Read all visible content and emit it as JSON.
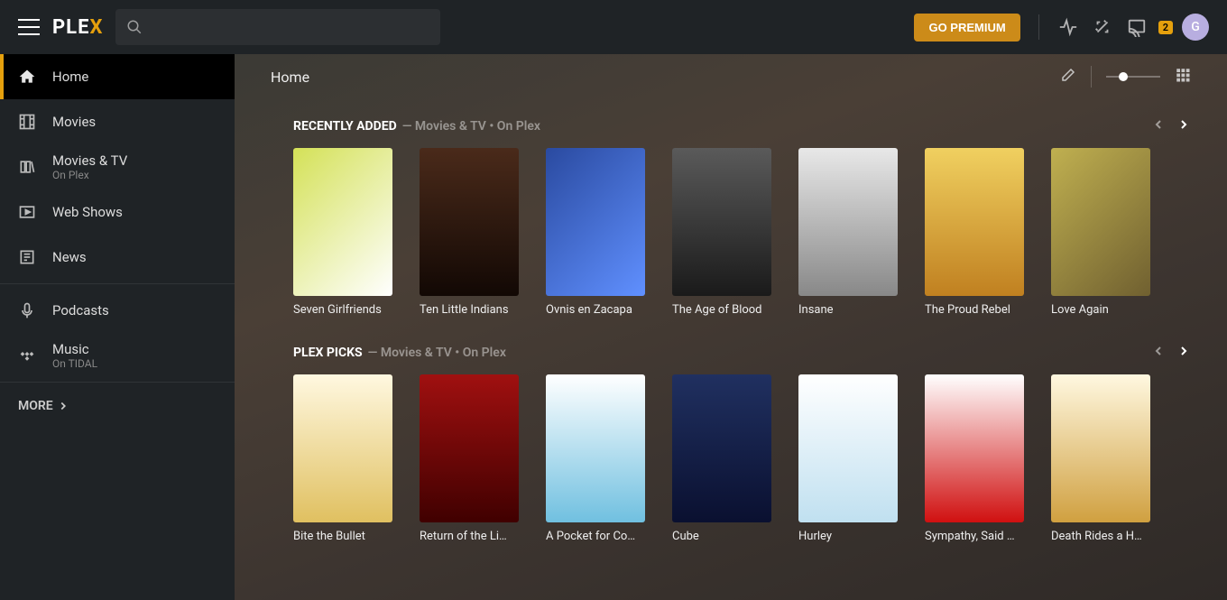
{
  "header": {
    "premium_label": "GO PREMIUM",
    "notification_count": "2",
    "avatar_letter": "G"
  },
  "sidebar": {
    "items": [
      {
        "label": "Home"
      },
      {
        "label": "Movies"
      },
      {
        "label": "Movies & TV",
        "sub": "On Plex"
      },
      {
        "label": "Web Shows"
      },
      {
        "label": "News"
      },
      {
        "label": "Podcasts"
      },
      {
        "label": "Music",
        "sub": "On TIDAL"
      }
    ],
    "more_label": "MORE"
  },
  "main": {
    "title": "Home"
  },
  "sections": [
    {
      "title": "RECENTLY ADDED",
      "subtitle": "— Movies & TV • On Plex",
      "items": [
        {
          "title": "Seven Girlfriends"
        },
        {
          "title": "Ten Little Indians"
        },
        {
          "title": "Ovnis en Zacapa"
        },
        {
          "title": "The Age of Blood"
        },
        {
          "title": "Insane"
        },
        {
          "title": "The Proud Rebel"
        },
        {
          "title": "Love Again"
        }
      ]
    },
    {
      "title": "PLEX PICKS",
      "subtitle": "— Movies & TV • On Plex",
      "items": [
        {
          "title": "Bite the Bullet"
        },
        {
          "title": "Return of the Li…"
        },
        {
          "title": "A Pocket for Co…"
        },
        {
          "title": "Cube"
        },
        {
          "title": "Hurley"
        },
        {
          "title": "Sympathy, Said …"
        },
        {
          "title": "Death Rides a H…"
        }
      ]
    }
  ]
}
